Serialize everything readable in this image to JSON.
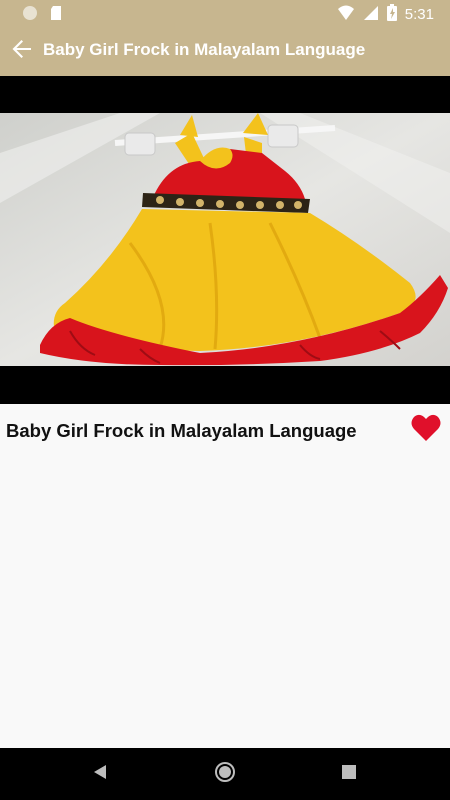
{
  "status_bar": {
    "time": "5:31",
    "icons": [
      "circle-notification-icon",
      "sd-card-icon",
      "wifi-icon",
      "signal-icon",
      "battery-charging-icon"
    ]
  },
  "app_bar": {
    "title": "Baby Girl Frock in Malayalam Language",
    "back_icon": "arrow-back-icon"
  },
  "video": {
    "thumbnail_subject": "yellow and red baby frock on hanger"
  },
  "content": {
    "title": "Baby Girl Frock in Malayalam Language",
    "favorite_icon": "heart-icon",
    "favorite_color": "#e0102b"
  },
  "nav_bar": {
    "icons": [
      "back-triangle-icon",
      "home-circle-icon",
      "recents-square-icon"
    ]
  },
  "colors": {
    "accent": "#c7b68f",
    "frock_yellow": "#f3c21c",
    "frock_red": "#d8141c"
  }
}
